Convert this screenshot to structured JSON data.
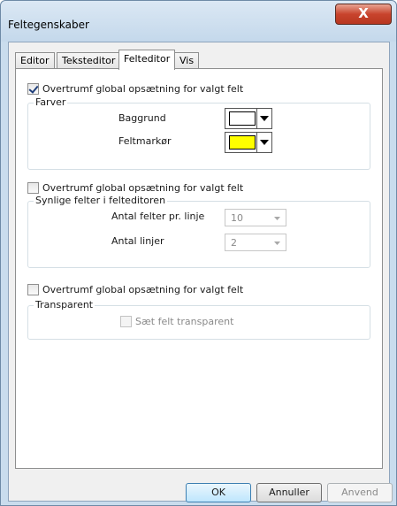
{
  "window": {
    "title": "Feltegenskaber",
    "close_glyph": "X"
  },
  "tabs": [
    {
      "label": "Editor",
      "active": false
    },
    {
      "label": "Teksteditor",
      "active": false
    },
    {
      "label": "Felteditor",
      "active": true
    },
    {
      "label": "Vis",
      "active": false
    }
  ],
  "colors_section": {
    "override_label": "Overtrumf global opsætning for valgt felt",
    "override_checked": true,
    "group_title": "Farver",
    "background_label": "Baggrund",
    "background_color": "#ffffff",
    "highlighter_label": "Feltmarkør",
    "highlighter_color": "#ffff00"
  },
  "visible_fields_section": {
    "override_label": "Overtrumf global opsætning for valgt felt",
    "override_checked": false,
    "group_title": "Synlige felter i felteditoren",
    "fields_per_line_label": "Antal felter pr. linje",
    "fields_per_line_value": "10",
    "lines_label": "Antal linjer",
    "lines_value": "2"
  },
  "transparent_section": {
    "override_label": "Overtrumf global opsætning for valgt felt",
    "override_checked": false,
    "group_title": "Transparent",
    "transparent_label": "Sæt felt transparent",
    "transparent_checked": false
  },
  "buttons": {
    "ok": "OK",
    "cancel": "Annuller",
    "apply": "Anvend"
  }
}
